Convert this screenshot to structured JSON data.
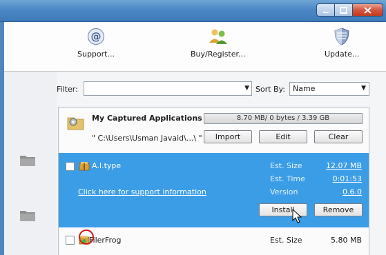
{
  "toolbar": {
    "support_label": "Support...",
    "buy_label": "Buy/Register...",
    "update_label": "Update..."
  },
  "filter": {
    "label": "Filter:",
    "value": ""
  },
  "sort": {
    "label": "Sort By:",
    "value": "Name"
  },
  "captured": {
    "title": "My Captured Applications",
    "usage": "8.70 MB/ 0 bytes / 3.39 GB",
    "path": "\" C:\\Users\\Usman Javaid\\...\\ \"",
    "import_label": "Import",
    "edit_label": "Edit",
    "clear_label": "Clear"
  },
  "apps": [
    {
      "name": "A.I.type",
      "selected": true,
      "support_link": "Click here for support information",
      "est_size_label": "Est. Size",
      "est_size": "12.07 MB",
      "est_time_label": "Est. Time",
      "est_time": "0:01:53",
      "version_label": "Version",
      "version": "0.6.0",
      "install_label": "Install",
      "remove_label": "Remove"
    },
    {
      "name": "FilerFrog",
      "selected": false,
      "est_size_label": "Est. Size",
      "est_size": "5.80 MB"
    }
  ],
  "colors": {
    "selected_row": "#3c9de7",
    "titlebar": "#4a86c5",
    "close_button": "#c23a1f",
    "annotation_circle": "#d21a1a"
  }
}
